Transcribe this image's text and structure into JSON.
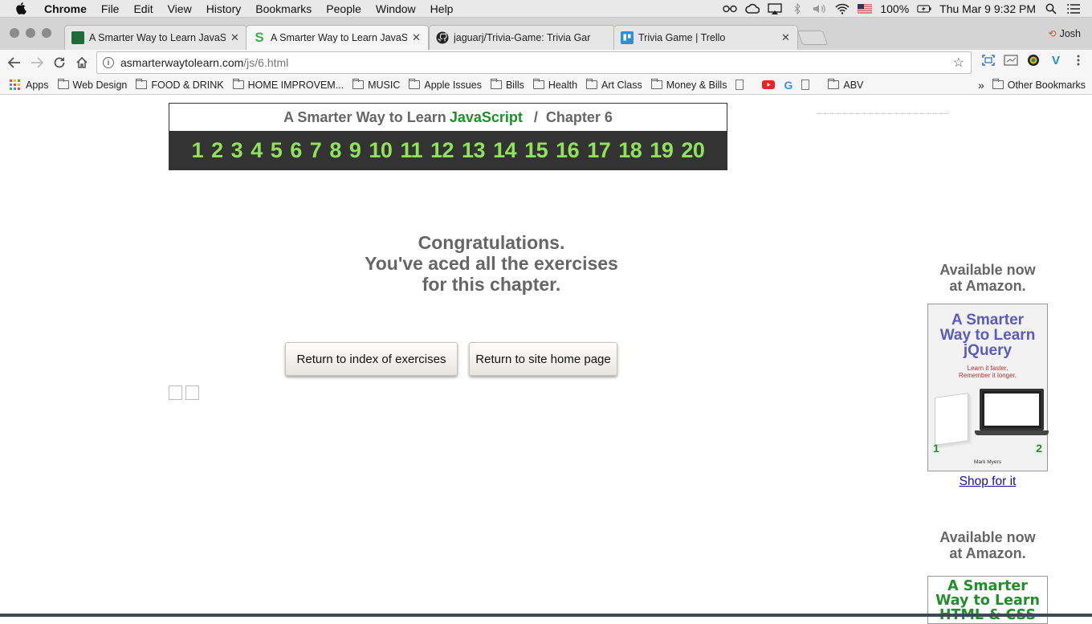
{
  "menubar": {
    "app": "Chrome",
    "items": [
      "File",
      "Edit",
      "View",
      "History",
      "Bookmarks",
      "People",
      "Window",
      "Help"
    ],
    "battery": "100%",
    "clock": "Thu Mar 9  9:32 PM"
  },
  "tabs": [
    {
      "title": "A Smarter Way to Learn JavaS",
      "favicon_color": "#1d6b3a",
      "favicon_letter": ""
    },
    {
      "title": "A Smarter Way to Learn JavaS",
      "favicon_color": "#3cb04a",
      "favicon_letter": "S"
    },
    {
      "title": "jaguarj/Trivia-Game: Trivia Gar",
      "favicon_color": "#222222",
      "favicon_letter": ""
    },
    {
      "title": "Trivia Game | Trello",
      "favicon_color": "#2d8fd5",
      "favicon_letter": ""
    }
  ],
  "profile": "Josh",
  "omnibox": {
    "host": "asmarterwaytolearn.com",
    "path": "/js/6.html"
  },
  "bookmarks": {
    "items": [
      "Apps",
      "Web Design",
      "FOOD & DRINK",
      "HOME IMPROVEM...",
      "MUSIC",
      "Apple Issues",
      "Bills",
      "Health",
      "Art Class",
      "Money & Bills",
      "ABV"
    ],
    "more": "»",
    "other": "Other Bookmarks"
  },
  "chapter": {
    "prefix": "A Smarter Way to Learn",
    "language": "JavaScript",
    "separator": "/",
    "label": "Chapter 6",
    "numbers": [
      "1",
      "2",
      "3",
      "4",
      "5",
      "6",
      "7",
      "8",
      "9",
      "10",
      "11",
      "12",
      "13",
      "14",
      "15",
      "16",
      "17",
      "18",
      "19",
      "20"
    ]
  },
  "message": {
    "line1": "Congratulations.",
    "line2": "You've aced all the exercises",
    "line3": "for this chapter."
  },
  "buttons": {
    "index": "Return to index of exercises",
    "home": "Return to site home page"
  },
  "ads": {
    "heading1a": "Available now",
    "heading1b": "at Amazon.",
    "book1_title": [
      "A Smarter",
      "Way to Learn",
      "jQuery"
    ],
    "book1_sub": [
      "Learn it faster.",
      "Remember it longer."
    ],
    "book1_author": "Mark Myers",
    "shop": "Shop for it",
    "heading2a": "Available now",
    "heading2b": "at Amazon.",
    "book2_title": [
      "A Smarter",
      "Way to Learn",
      "HTML & CSS"
    ]
  },
  "colors": {
    "accent_green": "#1f8f2a",
    "chapter_numbers": "#8fe35a",
    "link": "#1a0dab"
  }
}
